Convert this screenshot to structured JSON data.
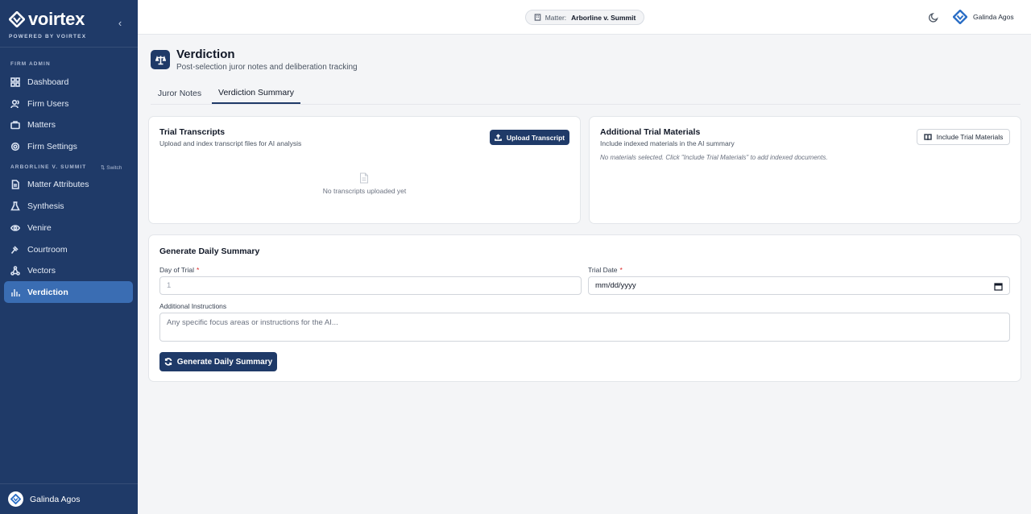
{
  "brand": {
    "name": "voirtex",
    "tagline": "POWERED BY VOIRTEX"
  },
  "sidebar": {
    "firm_section_label": "FIRM ADMIN",
    "firm_items": [
      {
        "label": "Dashboard",
        "icon": "grid-icon"
      },
      {
        "label": "Firm Users",
        "icon": "users-icon"
      },
      {
        "label": "Matters",
        "icon": "briefcase-icon"
      },
      {
        "label": "Firm Settings",
        "icon": "gear-icon"
      }
    ],
    "matter_section_label": "ARBORLINE V. SUMMIT",
    "switch_label": "⇅ Switch",
    "matter_items": [
      {
        "label": "Matter Attributes",
        "icon": "document-icon"
      },
      {
        "label": "Synthesis",
        "icon": "flask-icon"
      },
      {
        "label": "Venire",
        "icon": "eye-icon"
      },
      {
        "label": "Courtroom",
        "icon": "gavel-icon"
      },
      {
        "label": "Vectors",
        "icon": "network-icon"
      },
      {
        "label": "Verdiction",
        "icon": "bar-chart-icon",
        "active": true
      }
    ],
    "user_name": "Galinda Agos"
  },
  "topbar": {
    "matter_label": "Matter:",
    "matter_name": "Arborline v. Summit",
    "user_name": "Galinda Agos"
  },
  "page": {
    "title": "Verdiction",
    "subtitle": "Post-selection juror notes and deliberation tracking"
  },
  "tabs": [
    {
      "label": "Juror Notes",
      "active": false
    },
    {
      "label": "Verdiction Summary",
      "active": true
    }
  ],
  "transcripts": {
    "title": "Trial Transcripts",
    "subtitle": "Upload and index transcript files for AI analysis",
    "upload_button": "Upload Transcript",
    "empty_text": "No transcripts uploaded yet"
  },
  "materials": {
    "title": "Additional Trial Materials",
    "subtitle": "Include indexed materials in the AI summary",
    "include_button": "Include Trial Materials",
    "empty_text": "No materials selected. Click \"Include Trial Materials\" to add indexed documents."
  },
  "summary_form": {
    "title": "Generate Daily Summary",
    "day_label": "Day of Trial",
    "day_placeholder": "1",
    "date_label": "Trial Date",
    "date_value": "mm/dd/yyyy",
    "required_mark": "*",
    "instructions_label": "Additional Instructions",
    "instructions_placeholder": "Any specific focus areas or instructions for the AI...",
    "generate_button": "Generate Daily Summary"
  },
  "colors": {
    "sidebar_bg": "#1f3a68",
    "active_item": "#3a6db3",
    "primary": "#1f3a68",
    "required": "#dc2626"
  }
}
